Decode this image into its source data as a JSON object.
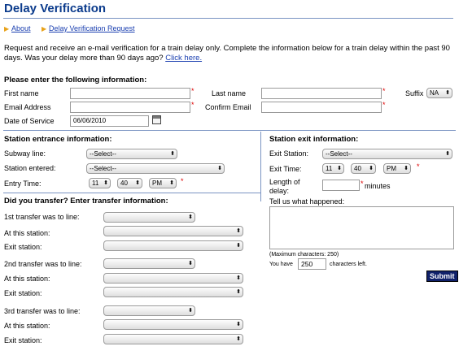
{
  "page": {
    "title": "Delay Verification"
  },
  "nav": {
    "about": "About",
    "request": "Delay Verification Request"
  },
  "intro": {
    "text": "Request and receive an e-mail verification for a train delay only. Complete the information below for a train delay within the past 90 days. Was your delay more than 90 days ago?",
    "link": "Click here."
  },
  "info": {
    "heading": "Please enter the following information:",
    "first_name": "First name",
    "last_name": "Last name",
    "suffix": "Suffix",
    "suffix_value": "NA",
    "email": "Email Address",
    "confirm_email": "Confirm Email",
    "date_of_service": "Date of Service",
    "date_value": "06/06/2010",
    "required_mark": "*"
  },
  "entrance": {
    "heading": "Station entrance information:",
    "subway_line": "Subway line:",
    "subway_line_value": "--Select--",
    "station_entered": "Station entered:",
    "station_entered_value": "--Select--",
    "entry_time": "Entry Time:",
    "hour": "11",
    "minute": "40",
    "ampm": "PM"
  },
  "exit": {
    "heading": "Station exit information:",
    "exit_station": "Exit Station:",
    "exit_station_value": "--Select--",
    "exit_time": "Exit Time:",
    "hour": "11",
    "minute": "40",
    "ampm": "PM",
    "length_label_1": "Length of",
    "length_label_2": "delay:",
    "minutes": "minutes",
    "tell_us": "Tell us what happened:",
    "max_chars": "(Maximum characters: 250)",
    "you_have": "You have",
    "chars_left_value": "250",
    "chars_left": "characters left.",
    "submit": "Submit"
  },
  "transfer": {
    "heading": "Did you transfer? Enter transfer information:",
    "t1": "1st transfer was to line:",
    "t2": "2nd transfer was to line:",
    "t3": "3rd transfer was to line:",
    "at_station": "At this station:",
    "exit_station": "Exit station:"
  }
}
